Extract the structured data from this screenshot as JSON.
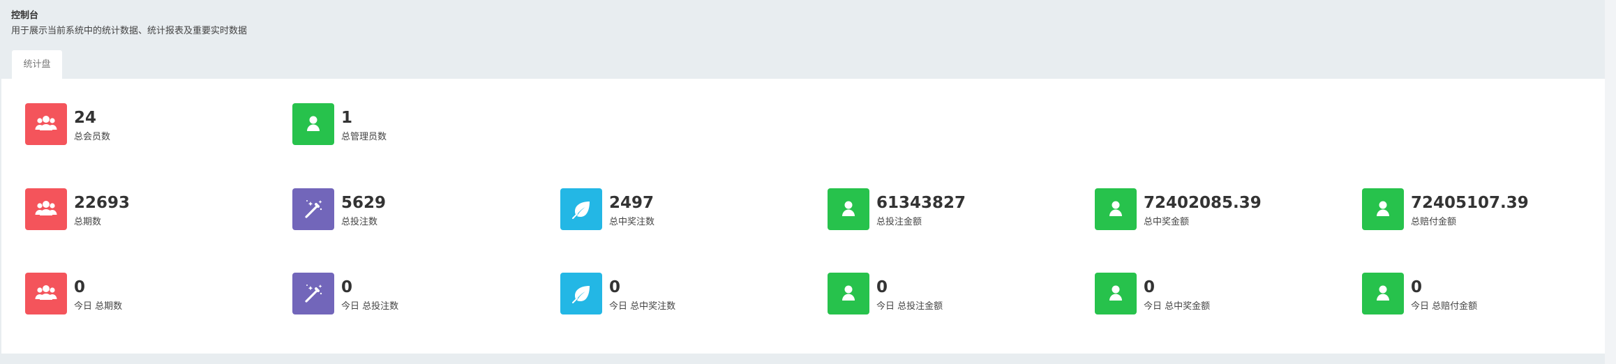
{
  "header": {
    "title": "控制台",
    "description": "用于展示当前系统中的统计数据、统计报表及重要实时数据"
  },
  "tabs": [
    {
      "label": "统计盘"
    }
  ],
  "colors": {
    "red": "#f4545b",
    "green": "#27c24c",
    "purple": "#7266ba",
    "cyan": "#23b7e5"
  },
  "stats": [
    {
      "value": "24",
      "label": "总会员数",
      "icon": "users-icon",
      "color": "#f4545b"
    },
    {
      "value": "1",
      "label": "总管理员数",
      "icon": "user-icon",
      "color": "#27c24c"
    },
    {
      "value": "22693",
      "label": "总期数",
      "icon": "users-icon",
      "color": "#f4545b"
    },
    {
      "value": "5629",
      "label": "总投注数",
      "icon": "magic-wand-icon",
      "color": "#7266ba"
    },
    {
      "value": "2497",
      "label": "总中奖注数",
      "icon": "leaf-icon",
      "color": "#23b7e5"
    },
    {
      "value": "61343827",
      "label": "总投注金额",
      "icon": "user-icon",
      "color": "#27c24c"
    },
    {
      "value": "72402085.39",
      "label": "总中奖金额",
      "icon": "user-icon",
      "color": "#27c24c"
    },
    {
      "value": "72405107.39",
      "label": "总赔付金额",
      "icon": "user-icon",
      "color": "#27c24c"
    },
    {
      "value": "0",
      "label": "今日 总期数",
      "icon": "users-icon",
      "color": "#f4545b"
    },
    {
      "value": "0",
      "label": "今日 总投注数",
      "icon": "magic-wand-icon",
      "color": "#7266ba"
    },
    {
      "value": "0",
      "label": "今日 总中奖注数",
      "icon": "leaf-icon",
      "color": "#23b7e5"
    },
    {
      "value": "0",
      "label": "今日 总投注金额",
      "icon": "user-icon",
      "color": "#27c24c"
    },
    {
      "value": "0",
      "label": "今日 总中奖金额",
      "icon": "user-icon",
      "color": "#27c24c"
    },
    {
      "value": "0",
      "label": "今日 总赔付金额",
      "icon": "user-icon",
      "color": "#27c24c"
    }
  ]
}
